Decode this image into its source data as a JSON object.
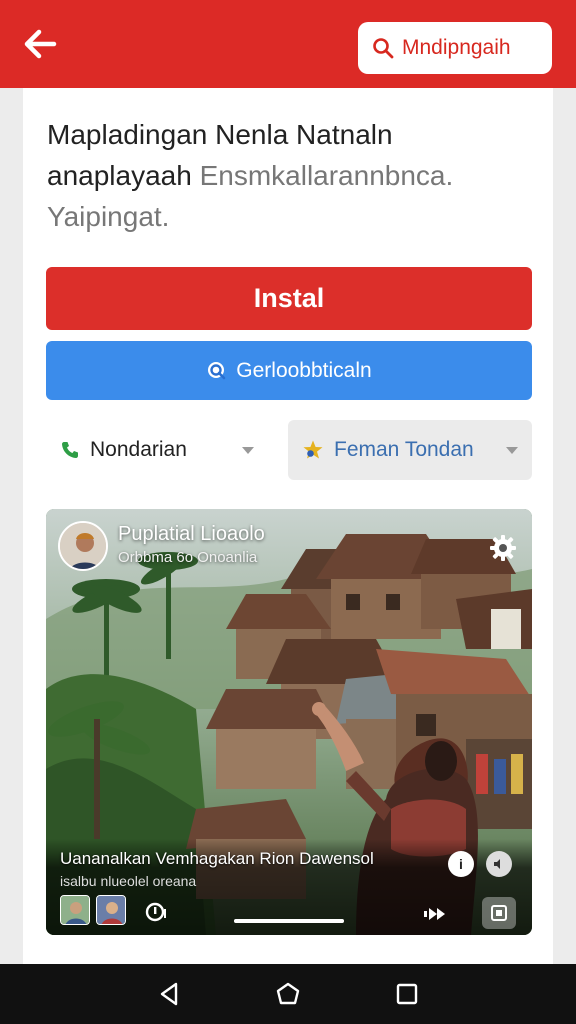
{
  "header": {
    "search_label": "Mndipngaih",
    "icons": {
      "back": "back-arrow-icon",
      "search": "search-icon"
    },
    "background": "#dc2a26"
  },
  "description": {
    "line1": "Mapladingan Nenla Natnaln",
    "line2_main": "anaplayaah ",
    "line2_muted": "Ensmkallarannbnca.",
    "line3": "Yaipingat."
  },
  "buttons": {
    "install_label": "Instal",
    "install_color": "#dc2f2a",
    "secondary_label": "Gerloobbticaln",
    "secondary_color": "#3b8ceb"
  },
  "dropdowns": [
    {
      "label": "Nondarian",
      "icon": "phone-icon"
    },
    {
      "label": "Feman Tondan",
      "icon": "star-icon"
    }
  ],
  "media": {
    "poster_name": "Puplatial Lioaolo",
    "poster_subtitle": "Orbbma 6o Onoanlia",
    "caption_title": "Uananalkan Vemhagakan Rion Dawensol",
    "caption_subtitle": "isalbu nlueolel oreana",
    "progress": 1.0,
    "controls": [
      "info-icon",
      "mute-icon",
      "settings-icon",
      "share-icon",
      "fast-forward-icon",
      "fullscreen-icon"
    ]
  },
  "navbar": {
    "icons": [
      "nav-back-icon",
      "nav-home-icon",
      "nav-recents-icon"
    ]
  }
}
